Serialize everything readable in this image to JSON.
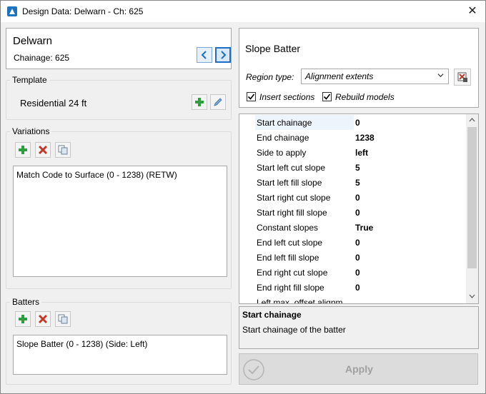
{
  "window": {
    "title": "Design Data: Delwarn - Ch: 625"
  },
  "header": {
    "name": "Delwarn",
    "chainage": "Chainage: 625"
  },
  "template": {
    "group_label": "Template",
    "value": "Residential 24 ft"
  },
  "variations": {
    "group_label": "Variations",
    "items": [
      "Match Code to Surface (0 - 1238) (RETW)"
    ]
  },
  "batters": {
    "group_label": "Batters",
    "items": [
      "Slope Batter (0 - 1238) (Side: Left)"
    ]
  },
  "detail": {
    "title": "Slope Batter",
    "region_type_label": "Region type:",
    "region_type_value": "Alignment extents",
    "insert_sections_label": "Insert sections",
    "insert_sections_checked": true,
    "rebuild_models_label": "Rebuild models",
    "rebuild_models_checked": true
  },
  "properties": [
    {
      "name": "Start chainage",
      "value": "0"
    },
    {
      "name": "End chainage",
      "value": "1238"
    },
    {
      "name": "Side to apply",
      "value": "left"
    },
    {
      "name": "Start left cut slope",
      "value": "5"
    },
    {
      "name": "Start left fill slope",
      "value": "5"
    },
    {
      "name": "Start right cut slope",
      "value": "0"
    },
    {
      "name": "Start right fill slope",
      "value": "0"
    },
    {
      "name": "Constant slopes",
      "value": "True"
    },
    {
      "name": "End left cut slope",
      "value": "0"
    },
    {
      "name": "End left fill slope",
      "value": "0"
    },
    {
      "name": "End right cut slope",
      "value": "0"
    },
    {
      "name": "End right fill slope",
      "value": "0"
    },
    {
      "name": "Left max. offset alignm",
      "value": ""
    }
  ],
  "description": {
    "title": "Start chainage",
    "text": "Start chainage of the batter"
  },
  "apply": {
    "label": "Apply"
  },
  "colors": {
    "accent": "#1e6ec8",
    "add_green": "#2e9e3e",
    "delete_red": "#c0392b"
  }
}
